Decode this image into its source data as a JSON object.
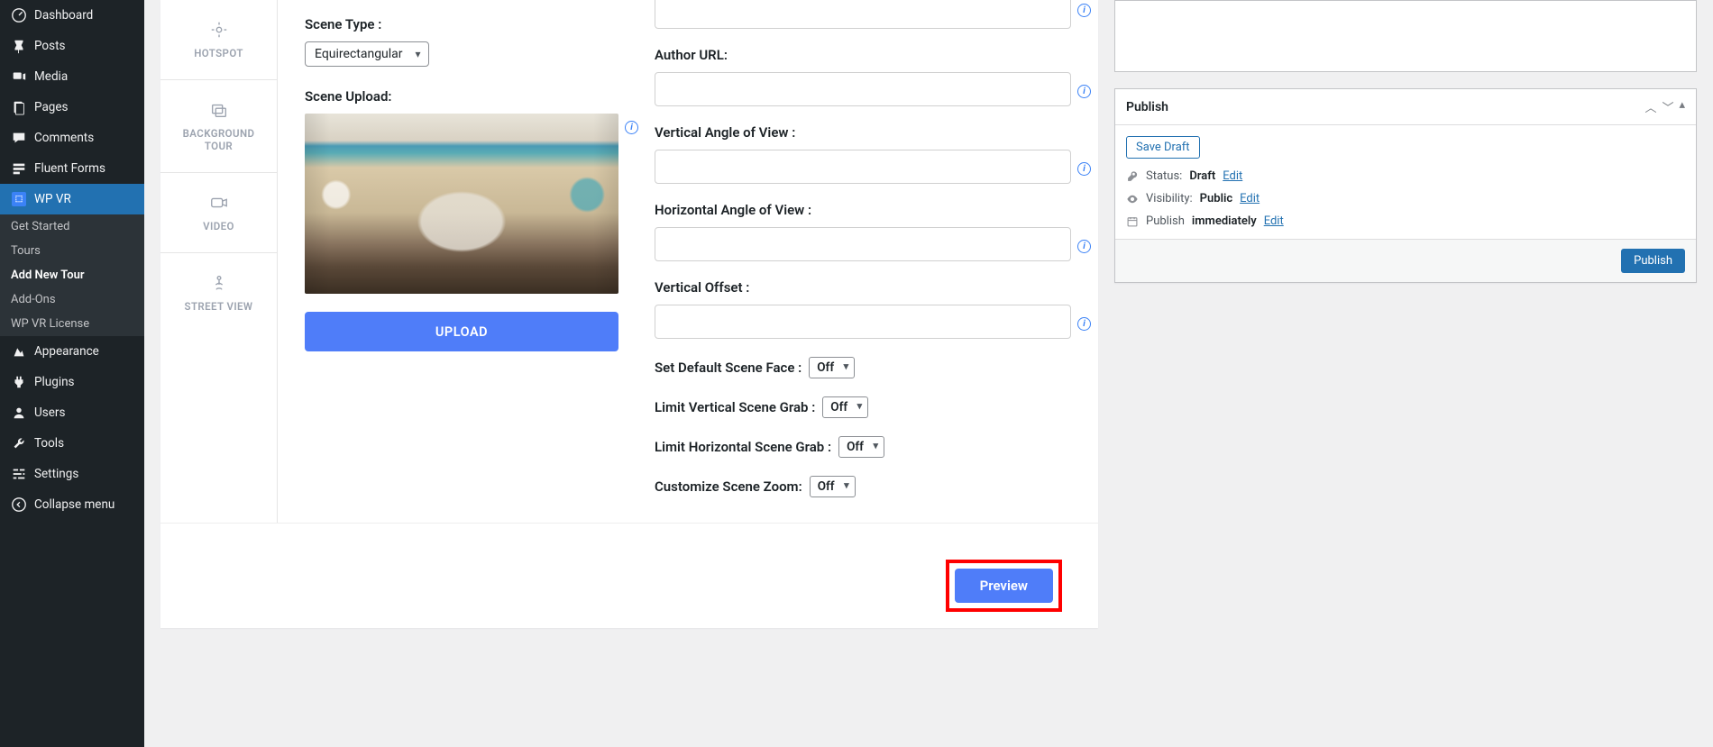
{
  "sidebar": {
    "items": [
      {
        "label": "Dashboard"
      },
      {
        "label": "Posts"
      },
      {
        "label": "Media"
      },
      {
        "label": "Pages"
      },
      {
        "label": "Comments"
      },
      {
        "label": "Fluent Forms"
      },
      {
        "label": "WP VR"
      }
    ],
    "submenu": [
      {
        "label": "Get Started"
      },
      {
        "label": "Tours"
      },
      {
        "label": "Add New Tour"
      },
      {
        "label": "Add-Ons"
      },
      {
        "label": "WP VR License"
      }
    ],
    "items2": [
      {
        "label": "Appearance"
      },
      {
        "label": "Plugins"
      },
      {
        "label": "Users"
      },
      {
        "label": "Tools"
      },
      {
        "label": "Settings"
      },
      {
        "label": "Collapse menu"
      }
    ]
  },
  "tabs": [
    {
      "label": "HOTSPOT"
    },
    {
      "label": "BACKGROUND TOUR"
    },
    {
      "label": "VIDEO"
    },
    {
      "label": "STREET VIEW"
    }
  ],
  "leftFields": {
    "sceneType": {
      "label": "Scene Type :",
      "value": "Equirectangular"
    },
    "sceneUpload": {
      "label": "Scene Upload:"
    },
    "uploadBtn": "UPLOAD"
  },
  "rightFields": {
    "authorUrl": {
      "label": "Author URL:",
      "value": ""
    },
    "vaov": {
      "label": "Vertical Angle of View :",
      "value": ""
    },
    "haov": {
      "label": "Horizontal Angle of View :",
      "value": ""
    },
    "voffset": {
      "label": "Vertical Offset :",
      "value": ""
    },
    "defaultFace": {
      "label": "Set Default Scene Face :",
      "value": "Off"
    },
    "limitV": {
      "label": "Limit Vertical Scene Grab :",
      "value": "Off"
    },
    "limitH": {
      "label": "Limit Horizontal Scene Grab :",
      "value": "Off"
    },
    "zoom": {
      "label": "Customize Scene Zoom:",
      "value": "Off"
    }
  },
  "previewBtn": "Preview",
  "publish": {
    "title": "Publish",
    "saveDraft": "Save Draft",
    "statusLabel": "Status:",
    "statusValue": "Draft",
    "visibilityLabel": "Visibility:",
    "visibilityValue": "Public",
    "publishLabel": "Publish",
    "publishValue": "immediately",
    "edit": "Edit",
    "publishBtn": "Publish"
  }
}
